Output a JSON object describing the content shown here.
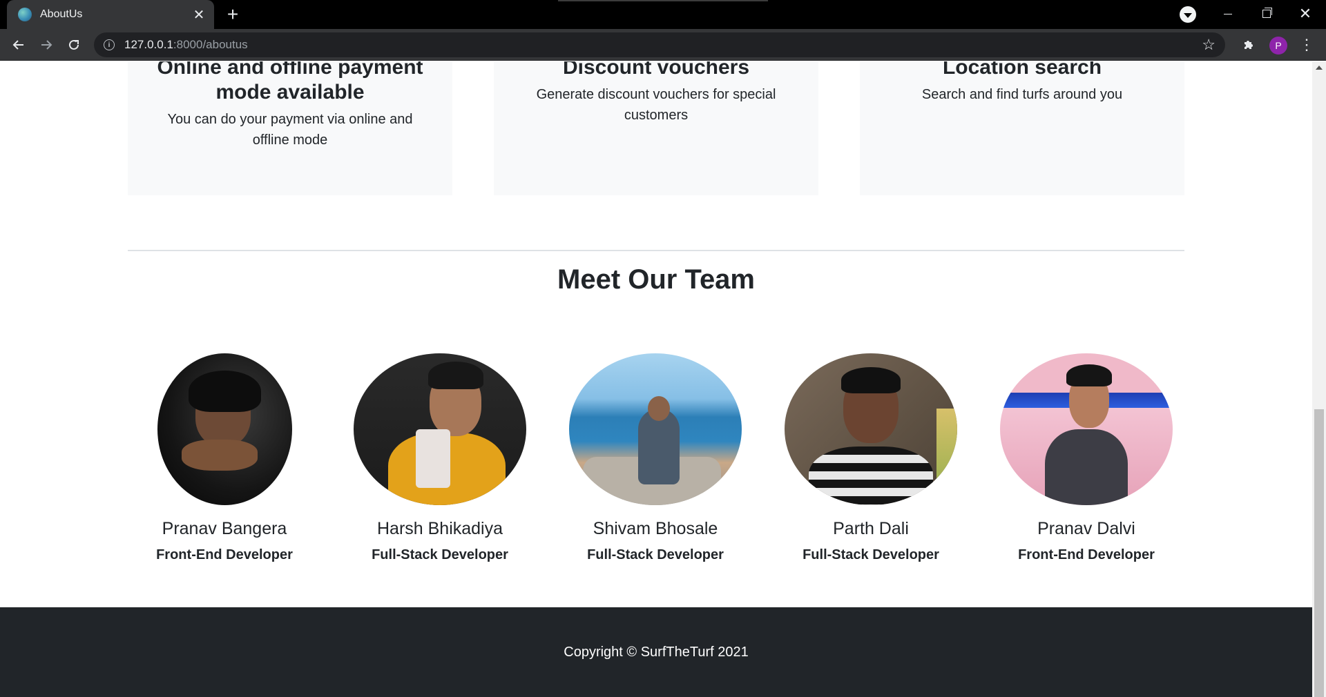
{
  "browser": {
    "tab_title": "AboutUs",
    "tab_close": "✕",
    "new_tab": "+",
    "url_host": "127.0.0.1",
    "url_path": ":8000/aboutus",
    "profile_initial": "P"
  },
  "features": [
    {
      "title": "Online and offline payment mode available",
      "description": "You can do your payment via online and offline mode"
    },
    {
      "title": "Discount vouchers",
      "description": "Generate discount vouchers for special customers"
    },
    {
      "title": "Location search",
      "description": "Search and find turfs around you"
    }
  ],
  "team": {
    "title": "Meet Our Team",
    "members": [
      {
        "name": "Pranav Bangera",
        "role": "Front-End Developer"
      },
      {
        "name": "Harsh Bhikadiya",
        "role": "Full-Stack Developer"
      },
      {
        "name": "Shivam Bhosale",
        "role": "Full-Stack Developer"
      },
      {
        "name": "Parth Dali",
        "role": "Full-Stack Developer"
      },
      {
        "name": "Pranav Dalvi",
        "role": "Front-End Developer"
      }
    ]
  },
  "footer": {
    "copyright": "Copyright © SurfTheTurf 2021"
  },
  "icons": {
    "back": "arrow-left-icon",
    "forward": "arrow-right-icon",
    "reload": "reload-icon",
    "info": "info-icon",
    "bookmark": "star-icon",
    "extensions": "puzzle-icon",
    "menu": "kebab-menu-icon"
  },
  "colors": {
    "footer_bg": "#212529",
    "card_bg": "#f8f9fa",
    "text": "#212529",
    "profile": "#8e24aa"
  }
}
